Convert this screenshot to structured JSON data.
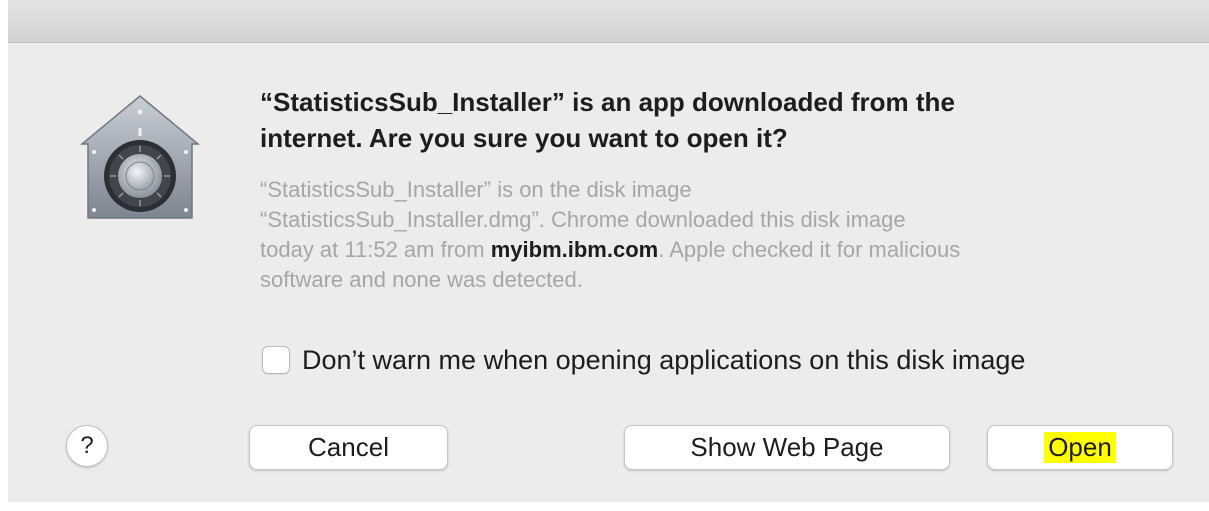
{
  "dialog": {
    "icon": "gatekeeper-vault-icon",
    "headline_line1": "“StatisticsSub_Installer” is an app downloaded from the",
    "headline_line2": "internet. Are you sure you want to open it?",
    "body": {
      "line1": "“StatisticsSub_Installer” is on the disk image",
      "line2": "“StatisticsSub_Installer.dmg”. Chrome downloaded this disk image",
      "line3_prefix": "today at 11:52 am from ",
      "line3_domain": "myibm.ibm.com",
      "line3_suffix": ". Apple checked it for malicious",
      "line4": "software and none was detected."
    },
    "checkbox": {
      "label": "Don’t warn me when opening applications on this disk image",
      "checked": false
    },
    "help_label": "?",
    "buttons": {
      "cancel": "Cancel",
      "show_web_page": "Show Web Page",
      "open": "Open"
    },
    "highlight_color": "#ffff00"
  }
}
